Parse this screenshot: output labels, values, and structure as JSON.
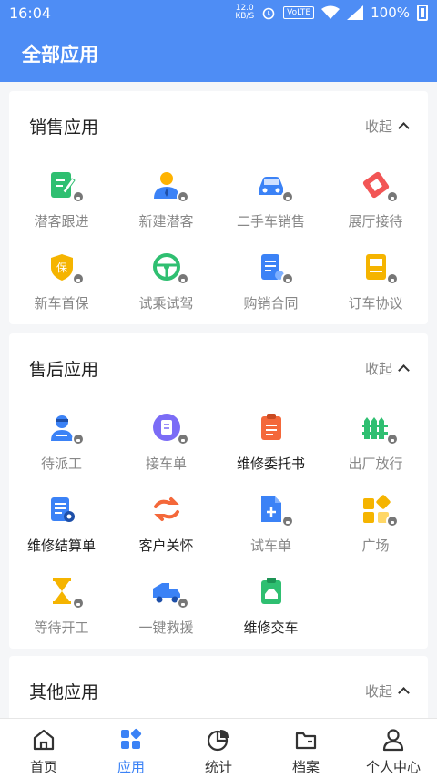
{
  "status_bar": {
    "time": "16:04",
    "net_speed_value": "12.0",
    "net_speed_unit": "KB/S",
    "volte": "VoLTE",
    "battery": "100%"
  },
  "header": {
    "title": "全部应用"
  },
  "sections": [
    {
      "title": "销售应用",
      "collapse_label": "收起",
      "apps": [
        {
          "label": "潜客跟进",
          "icon": "edit-note-icon",
          "locked": true,
          "active": false
        },
        {
          "label": "新建潜客",
          "icon": "user-add-icon",
          "locked": true,
          "active": false
        },
        {
          "label": "二手车销售",
          "icon": "car-icon",
          "locked": true,
          "active": false
        },
        {
          "label": "展厅接待",
          "icon": "reception-icon",
          "locked": true,
          "active": false
        },
        {
          "label": "新车首保",
          "icon": "shield-icon",
          "locked": true,
          "active": false
        },
        {
          "label": "试乘试驾",
          "icon": "steering-wheel-icon",
          "locked": true,
          "active": false
        },
        {
          "label": "购销合同",
          "icon": "contract-icon",
          "locked": true,
          "active": false
        },
        {
          "label": "订车协议",
          "icon": "agreement-icon",
          "locked": true,
          "active": false
        }
      ]
    },
    {
      "title": "售后应用",
      "collapse_label": "收起",
      "apps": [
        {
          "label": "待派工",
          "icon": "mechanic-icon",
          "locked": true,
          "active": false
        },
        {
          "label": "接车单",
          "icon": "receive-order-icon",
          "locked": true,
          "active": false
        },
        {
          "label": "维修委托书",
          "icon": "clipboard-icon",
          "locked": false,
          "active": true
        },
        {
          "label": "出厂放行",
          "icon": "gate-icon",
          "locked": true,
          "active": false
        },
        {
          "label": "维修结算单",
          "icon": "settlement-icon",
          "locked": false,
          "active": true
        },
        {
          "label": "客户关怀",
          "icon": "care-icon",
          "locked": false,
          "active": true
        },
        {
          "label": "试车单",
          "icon": "test-doc-icon",
          "locked": true,
          "active": false
        },
        {
          "label": "广场",
          "icon": "plaza-icon",
          "locked": true,
          "active": false
        },
        {
          "label": "等待开工",
          "icon": "hourglass-icon",
          "locked": true,
          "active": false
        },
        {
          "label": "一键救援",
          "icon": "rescue-truck-icon",
          "locked": true,
          "active": false
        },
        {
          "label": "维修交车",
          "icon": "delivery-doc-icon",
          "locked": false,
          "active": true
        }
      ]
    },
    {
      "title": "其他应用",
      "collapse_label": "收起",
      "apps": []
    }
  ],
  "tabs": [
    {
      "label": "首页",
      "icon": "home-icon",
      "active": false
    },
    {
      "label": "应用",
      "icon": "apps-icon",
      "active": true
    },
    {
      "label": "统计",
      "icon": "pie-chart-icon",
      "active": false
    },
    {
      "label": "档案",
      "icon": "folder-icon",
      "active": false
    },
    {
      "label": "个人中心",
      "icon": "user-icon",
      "active": false
    }
  ],
  "colors": {
    "primary": "#4e8df5",
    "tab_active": "#3b82f6",
    "text_dark": "#222222",
    "text_muted": "#888888"
  }
}
